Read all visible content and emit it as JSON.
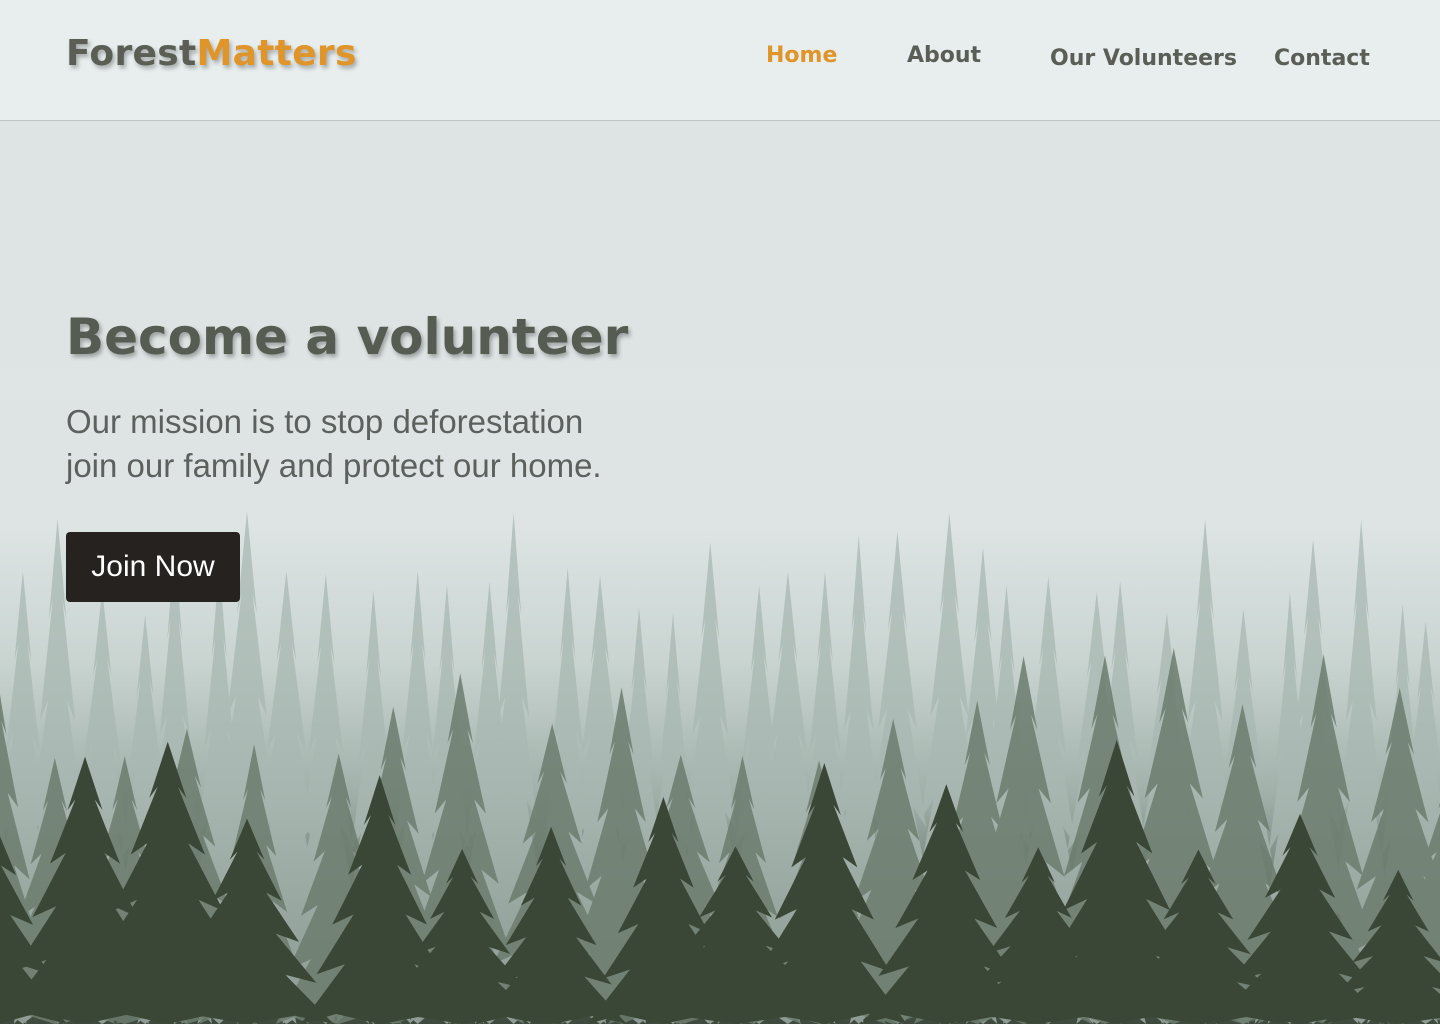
{
  "brand": {
    "part1": "Forest",
    "part2": "Matters",
    "color_dark": "#5a5e55",
    "color_accent": "#e0952a"
  },
  "nav": {
    "items": [
      {
        "label": "Home",
        "active": true
      },
      {
        "label": "About",
        "active": false
      },
      {
        "label": "Our Volunteers",
        "active": false
      },
      {
        "label": "Contact",
        "active": false
      }
    ]
  },
  "hero": {
    "title": "Become a volunteer",
    "line1": "Our mission is to stop deforestation",
    "line2": "join our family and protect our home.",
    "button_label": "Join Now",
    "background": "misty-pine-forest-photo"
  },
  "colors": {
    "header_bg": "#e8eeee",
    "text": "#5b5e56",
    "button_bg": "#262220",
    "button_text": "#ffffff"
  }
}
